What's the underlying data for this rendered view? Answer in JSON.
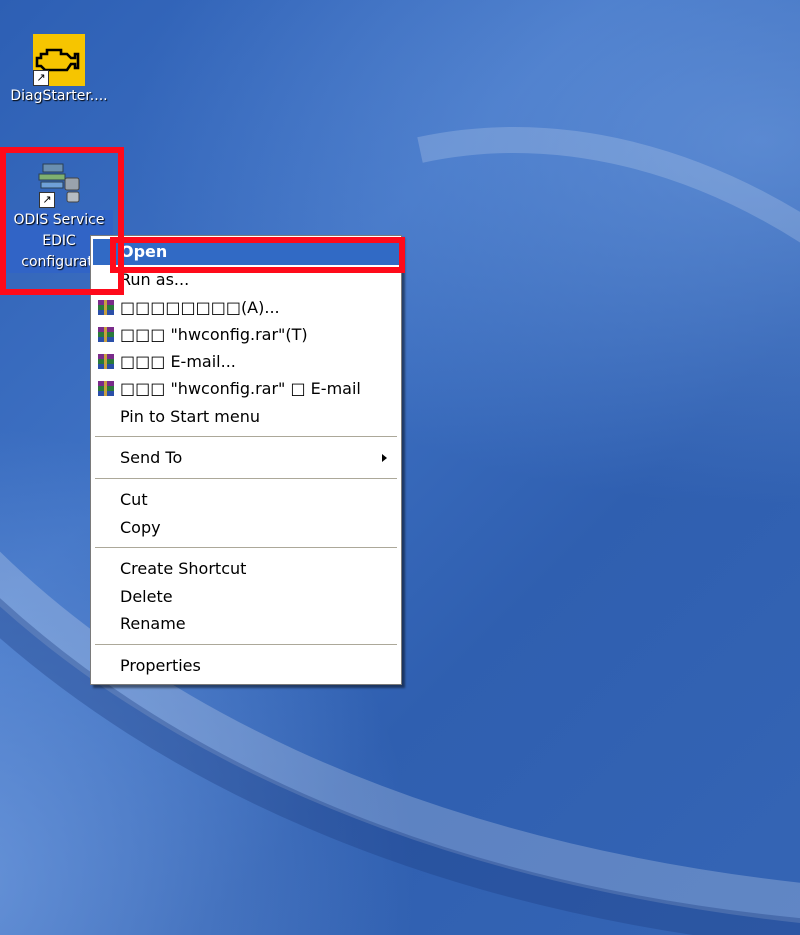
{
  "desktop": {
    "icons": [
      {
        "label": "DiagStarter...."
      },
      {
        "label_lines": [
          "ODIS Service",
          "EDIC",
          "configurati"
        ]
      }
    ]
  },
  "context_menu": {
    "items": [
      {
        "label": "Open",
        "selected": true
      },
      {
        "label": "Run as..."
      },
      {
        "label": "□□□□□□□□(A)...",
        "icon": "winrar-icon"
      },
      {
        "label": "□□□ \"hwconfig.rar\"(T)",
        "icon": "winrar-icon"
      },
      {
        "label": "□□□ E-mail...",
        "icon": "winrar-icon"
      },
      {
        "label": "□□□ \"hwconfig.rar\" □ E-mail",
        "icon": "winrar-icon"
      },
      {
        "label": "Pin to Start menu"
      },
      {
        "label": "Send To",
        "submenu": true
      },
      {
        "label": "Cut"
      },
      {
        "label": "Copy"
      },
      {
        "label": "Create Shortcut"
      },
      {
        "label": "Delete"
      },
      {
        "label": "Rename"
      },
      {
        "label": "Properties"
      }
    ]
  },
  "colors": {
    "highlight_box": "#ff0a1a",
    "menu_selection": "#316ac5",
    "desktop_blue": "#3a6cc0"
  }
}
